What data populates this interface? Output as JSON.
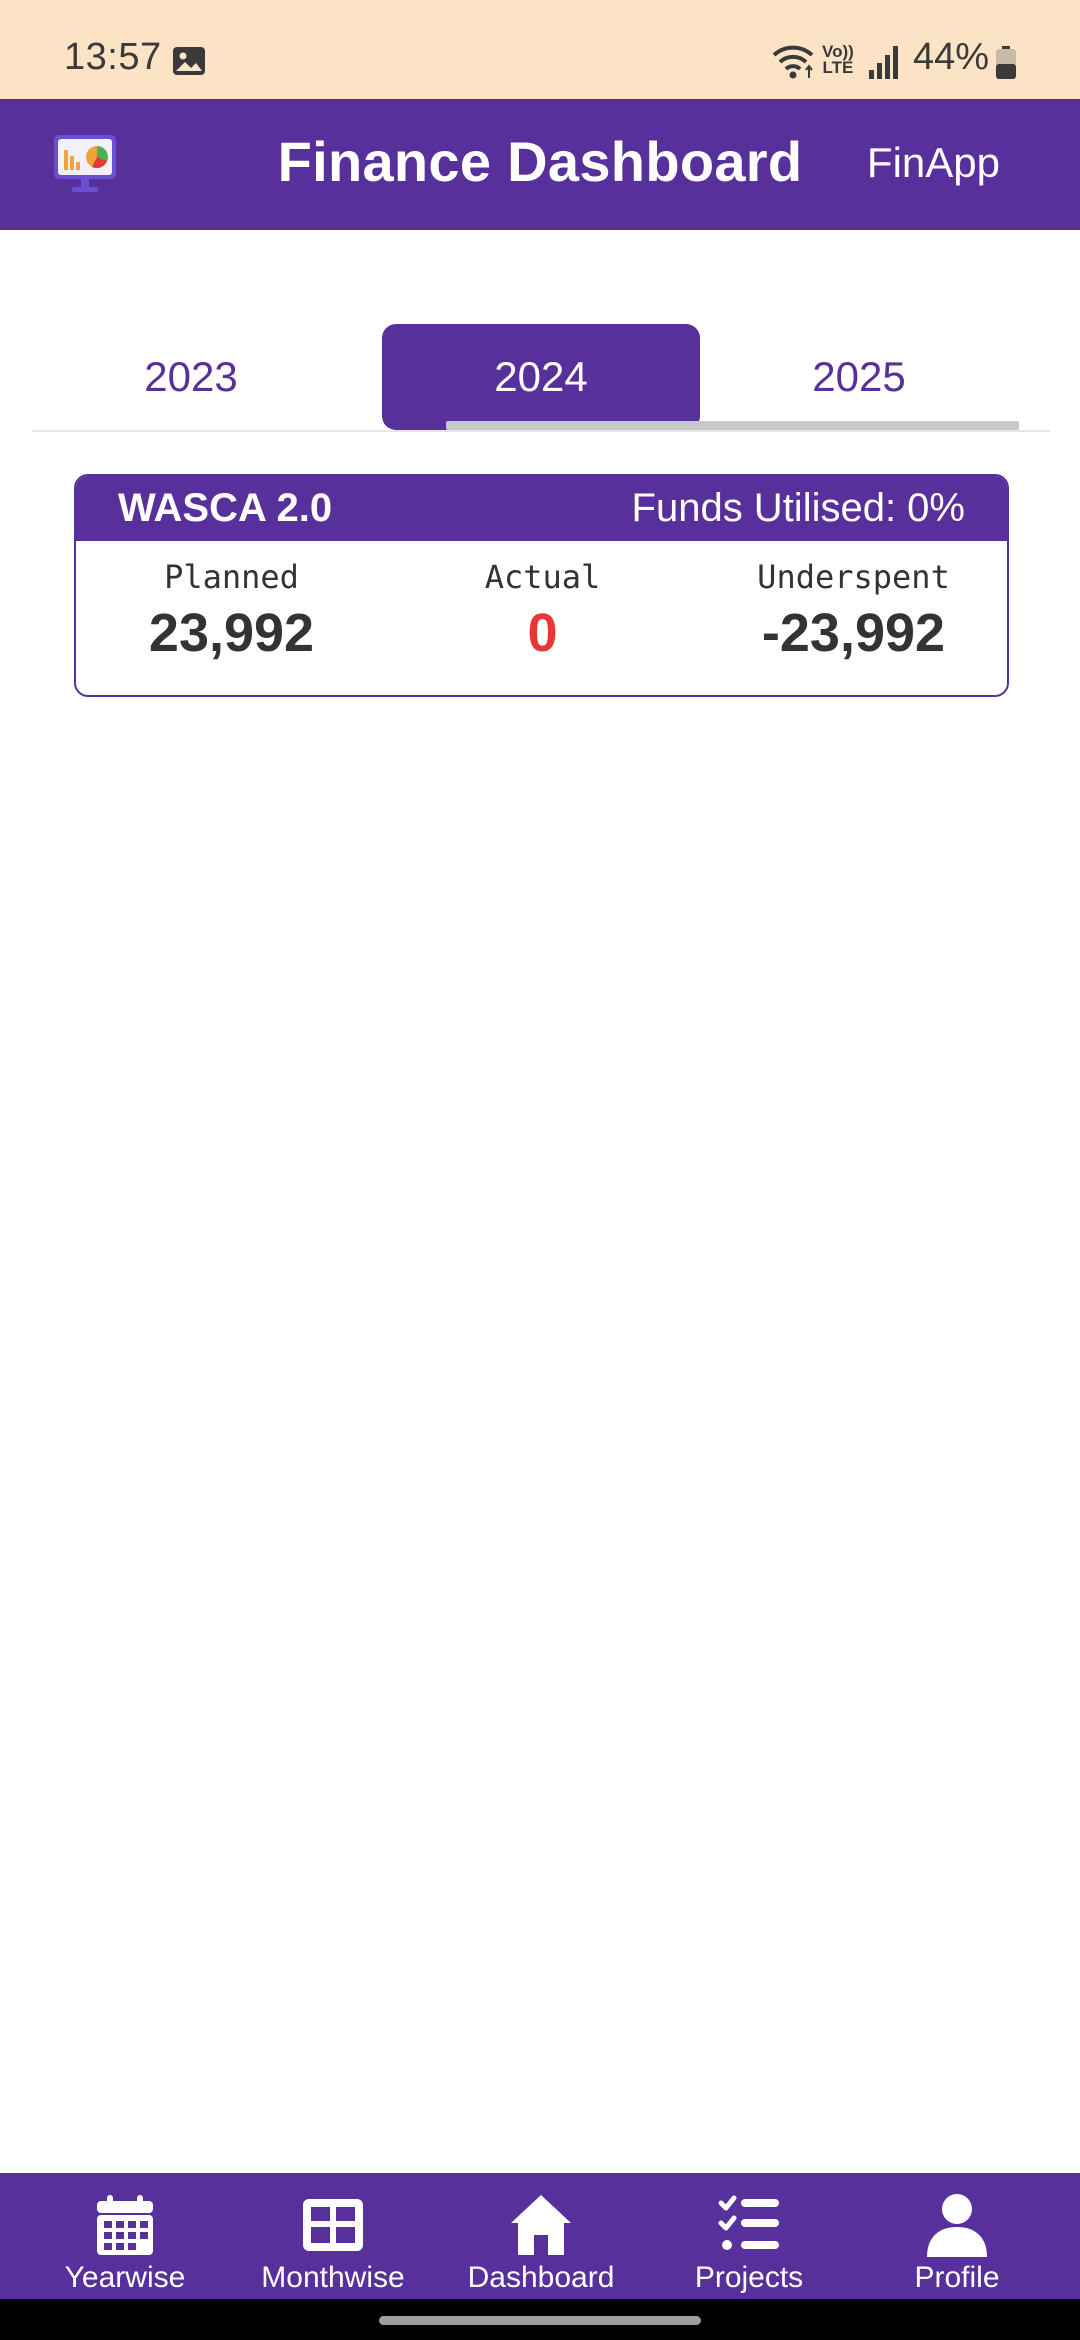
{
  "status_bar": {
    "time": "13:57",
    "volte_top": "Vo))",
    "volte_bottom": "LTE",
    "battery": "44%"
  },
  "app_bar": {
    "title": "Finance Dashboard",
    "brand": "FinApp",
    "logo_icon": "presentation-chart-icon"
  },
  "tabs": [
    {
      "label": "2023",
      "active": false
    },
    {
      "label": "2024",
      "active": true
    },
    {
      "label": "2025",
      "active": false
    }
  ],
  "projects": [
    {
      "name": "WASCA 2.0",
      "funds_utilised": "Funds Utilised: 0%",
      "planned_label": "Planned",
      "planned_value": "23,992",
      "actual_label": "Actual",
      "actual_value": "0",
      "underspent_label": "Underspent",
      "underspent_value": "-23,992"
    }
  ],
  "bottom_nav": [
    {
      "label": "Yearwise",
      "icon": "calendar-icon"
    },
    {
      "label": "Monthwise",
      "icon": "table-icon"
    },
    {
      "label": "Dashboard",
      "icon": "home-icon"
    },
    {
      "label": "Projects",
      "icon": "checklist-icon"
    },
    {
      "label": "Profile",
      "icon": "user-icon"
    }
  ],
  "colors": {
    "primary": "#58309b",
    "status_bar": "#fde3c6",
    "negative": "#e53935",
    "text": "#333333"
  }
}
